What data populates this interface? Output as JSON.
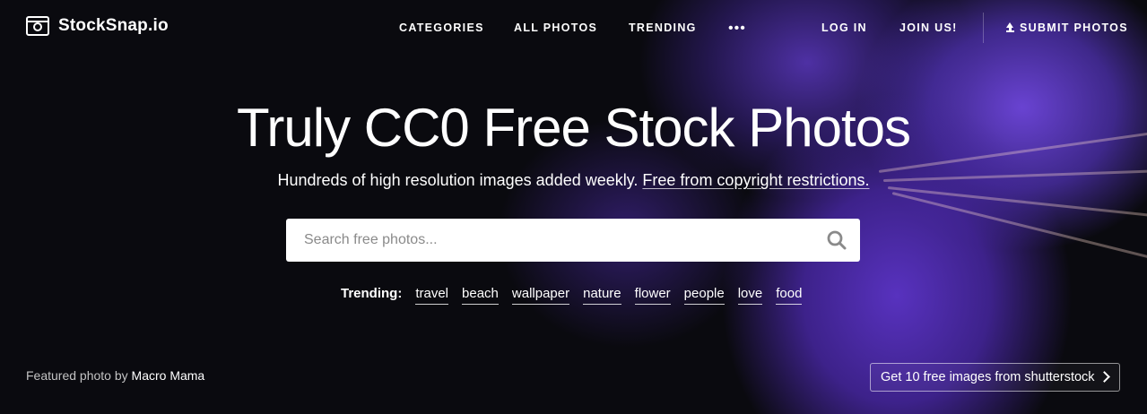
{
  "brand": {
    "name": "StockSnap.io"
  },
  "nav": {
    "categories": "CATEGORIES",
    "all_photos": "ALL PHOTOS",
    "trending": "TRENDING",
    "more": "•••",
    "login": "LOG IN",
    "join": "JOIN US!",
    "submit": "SUBMIT PHOTOS"
  },
  "hero": {
    "title": "Truly CC0 Free Stock Photos",
    "subtitle": "Hundreds of high resolution images added weekly.",
    "subtitle_link": "Free from copyright restrictions."
  },
  "search": {
    "placeholder": "Search free photos..."
  },
  "trending": {
    "label": "Trending:",
    "tags": [
      "travel",
      "beach",
      "wallpaper",
      "nature",
      "flower",
      "people",
      "love",
      "food"
    ]
  },
  "featured": {
    "prefix": "Featured photo by",
    "author": "Macro Mama"
  },
  "promo": {
    "label": "Get 10 free images from shutterstock"
  },
  "icons": {
    "logo": "camera-icon",
    "search": "search-icon",
    "upload": "upload-icon",
    "chevron": "chevron-right-icon"
  }
}
